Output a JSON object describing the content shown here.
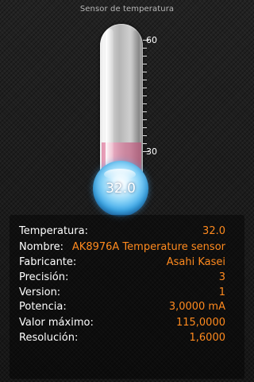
{
  "app": {
    "title": "Sensor de temperatura"
  },
  "thermometer": {
    "reading": "32.0",
    "scale_labels": [
      "60",
      "30"
    ],
    "mercury_color": "#e08eab",
    "bulb_color": "#3aa6e8"
  },
  "details": {
    "rows": [
      {
        "label": "Temperatura:",
        "value": "32.0"
      },
      {
        "label": "Nombre:",
        "value": "AK8976A Temperature sensor"
      },
      {
        "label": "Fabricante:",
        "value": "Asahi Kasei"
      },
      {
        "label": "Precisión:",
        "value": "3"
      },
      {
        "label": "Version:",
        "value": "1"
      },
      {
        "label": "Potencia:",
        "value": "3,0000 mA"
      },
      {
        "label": "Valor máximo:",
        "value": "115,0000"
      },
      {
        "label": "Resolución:",
        "value": "1,6000"
      }
    ],
    "value_color": "#ff8a1e"
  }
}
